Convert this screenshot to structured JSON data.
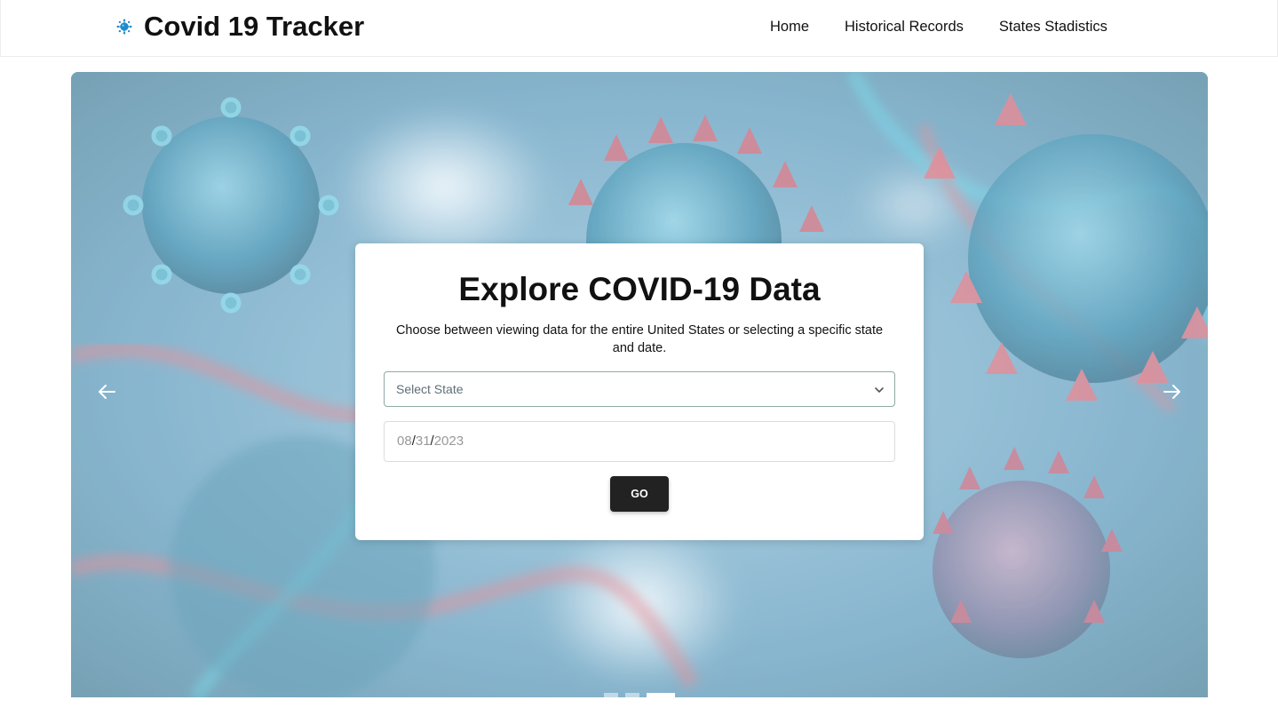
{
  "header": {
    "title": "Covid 19 Tracker",
    "logo_icon": "virus-icon",
    "logo_color": "#1f8ad0",
    "nav": [
      {
        "label": "Home"
      },
      {
        "label": "Historical Records"
      },
      {
        "label": "States Stadistics"
      }
    ]
  },
  "hero": {
    "background": "covid-virus-image",
    "prev_icon": "arrow-left-icon",
    "next_icon": "arrow-right-icon",
    "slides_total": 3,
    "active_slide": 3
  },
  "card": {
    "title": "Explore COVID-19 Data",
    "description": "Choose between viewing data for the entire United States or selecting a specific state and date.",
    "state_select": {
      "placeholder": "Select State",
      "icon": "chevron-down-icon"
    },
    "date": {
      "month": "08",
      "day": "31",
      "year": "2023",
      "separator": "/"
    },
    "go_label": "GO"
  },
  "colors": {
    "accent": "#1f8ad0",
    "button_bg": "#222222",
    "text": "#111111"
  }
}
